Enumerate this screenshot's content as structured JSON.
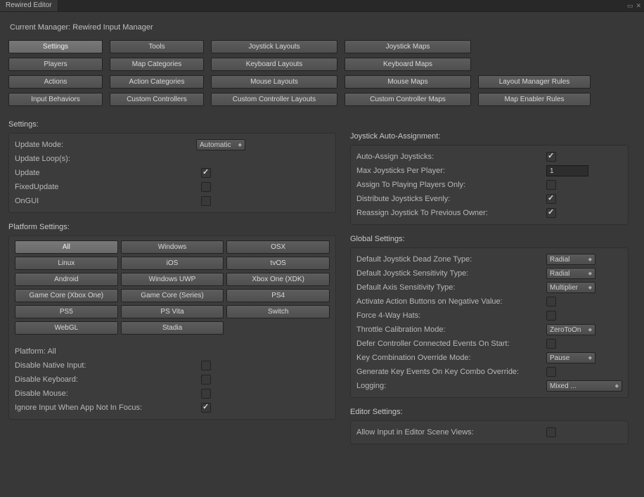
{
  "window": {
    "tab_title": "Rewired Editor"
  },
  "header": {
    "manager": "Current Manager: Rewired Input Manager"
  },
  "nav": {
    "r1c1": "Settings",
    "r1c2": "Tools",
    "r1c3": "Joystick Layouts",
    "r1c4": "Joystick Maps",
    "r2c1": "Players",
    "r2c2": "Map Categories",
    "r2c3": "Keyboard Layouts",
    "r2c4": "Keyboard Maps",
    "r3c1": "Actions",
    "r3c2": "Action Categories",
    "r3c3": "Mouse Layouts",
    "r3c4": "Mouse Maps",
    "r3c5": "Layout Manager Rules",
    "r4c1": "Input Behaviors",
    "r4c2": "Custom Controllers",
    "r4c3": "Custom Controller Layouts",
    "r4c4": "Custom Controller Maps",
    "r4c5": "Map Enabler Rules"
  },
  "left": {
    "settings_title": "Settings:",
    "update_mode_label": "Update Mode:",
    "update_mode_value": "Automatic",
    "update_loops_label": "Update Loop(s):",
    "loop_update": "Update",
    "loop_fixed": "FixedUpdate",
    "loop_ongui": "OnGUI",
    "platform_settings_title": "Platform Settings:",
    "platforms": {
      "all": "All",
      "windows": "Windows",
      "osx": "OSX",
      "linux": "Linux",
      "ios": "iOS",
      "tvos": "tvOS",
      "android": "Android",
      "uwp": "Windows UWP",
      "xboxone_xdk": "Xbox One (XDK)",
      "gc_xboxone": "Game Core (Xbox One)",
      "gc_series": "Game Core (Series)",
      "ps4": "PS4",
      "ps5": "PS5",
      "psvita": "PS Vita",
      "switch": "Switch",
      "webgl": "WebGL",
      "stadia": "Stadia"
    },
    "platform_label": "Platform: All",
    "disable_native": "Disable Native Input:",
    "disable_keyboard": "Disable Keyboard:",
    "disable_mouse": "Disable Mouse:",
    "ignore_focus": "Ignore Input When App Not In Focus:"
  },
  "right": {
    "jaa_title": "Joystick Auto-Assignment:",
    "auto_assign": "Auto-Assign Joysticks:",
    "max_per_player": "Max Joysticks Per Player:",
    "max_per_player_value": "1",
    "assign_playing": "Assign To Playing Players Only:",
    "distribute": "Distribute Joysticks Evenly:",
    "reassign": "Reassign Joystick To Previous Owner:",
    "global_title": "Global Settings:",
    "deadzone": "Default Joystick Dead Zone Type:",
    "deadzone_value": "Radial",
    "sensitivity": "Default Joystick Sensitivity Type:",
    "sensitivity_value": "Radial",
    "axis_sens": "Default Axis Sensitivity Type:",
    "axis_sens_value": "Multiplier",
    "activate_neg": "Activate Action Buttons on Negative Value:",
    "force_4way": "Force 4-Way Hats:",
    "throttle": "Throttle Calibration Mode:",
    "throttle_value": "ZeroToOn",
    "defer": "Defer Controller Connected Events On Start:",
    "keycombo": "Key Combination Override Mode:",
    "keycombo_value": "Pause",
    "genkey": "Generate Key Events On Key Combo Override:",
    "logging": "Logging:",
    "logging_value": "Mixed ...",
    "editor_title": "Editor Settings:",
    "allow_scene": "Allow Input in Editor Scene Views:"
  }
}
